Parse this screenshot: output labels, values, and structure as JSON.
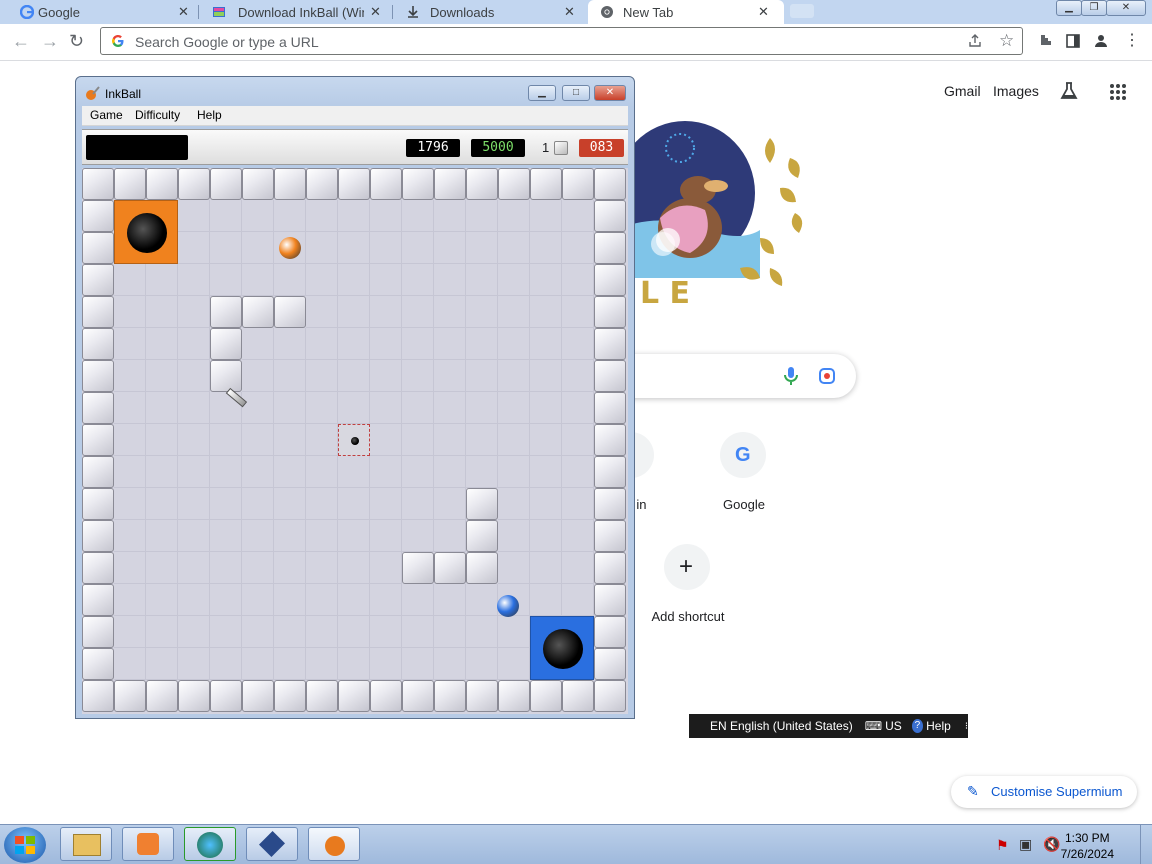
{
  "browser": {
    "tabs": [
      {
        "title": "Google",
        "active": false
      },
      {
        "title": "Download InkBall (Win",
        "active": false
      },
      {
        "title": "Downloads",
        "active": false
      },
      {
        "title": "New Tab",
        "active": true
      }
    ],
    "omnibox_placeholder": "Search Google or type a URL"
  },
  "ntp": {
    "gmail": "Gmail",
    "images": "Images",
    "doodle_letters": "L E",
    "shortcuts": [
      {
        "label": "n in"
      },
      {
        "label": "Google"
      },
      {
        "label": "Add shortcut"
      }
    ],
    "customise_label": "Customise Supermium"
  },
  "inkball": {
    "title": "InkBall",
    "menu": [
      "Game",
      "Difficulty",
      "Help"
    ],
    "score": "1796",
    "high_score": "5000",
    "level": "1",
    "timer": "083",
    "board_cols": 17,
    "board_rows": 17,
    "walls": [
      [
        4,
        4
      ],
      [
        5,
        4
      ],
      [
        6,
        4
      ],
      [
        4,
        5
      ],
      [
        4,
        6
      ],
      [
        12,
        10
      ],
      [
        12,
        11
      ],
      [
        10,
        12
      ],
      [
        11,
        12
      ],
      [
        12,
        12
      ]
    ],
    "balls": [
      {
        "color": "orange",
        "col": 6,
        "row": 2
      },
      {
        "color": "blue",
        "col": 12.8,
        "row": 13.2
      }
    ],
    "holes": [
      {
        "color": "orange",
        "col": 1,
        "row": 1,
        "size": 2
      },
      {
        "color": "blue",
        "col": 14,
        "row": 14,
        "size": 2
      },
      {
        "color": "gray",
        "col": 8,
        "row": 8,
        "size": 1
      }
    ],
    "colors": {
      "orange": "#f0821e",
      "blue": "#2a6fe0",
      "lcd_green": "#7ee06a",
      "lcd_red": "#e04a3a"
    }
  },
  "langbar": {
    "language": "EN English (United States)",
    "layout": "US",
    "help": "Help"
  },
  "taskbar": {
    "time": "1:30 PM",
    "date": "7/26/2024"
  }
}
